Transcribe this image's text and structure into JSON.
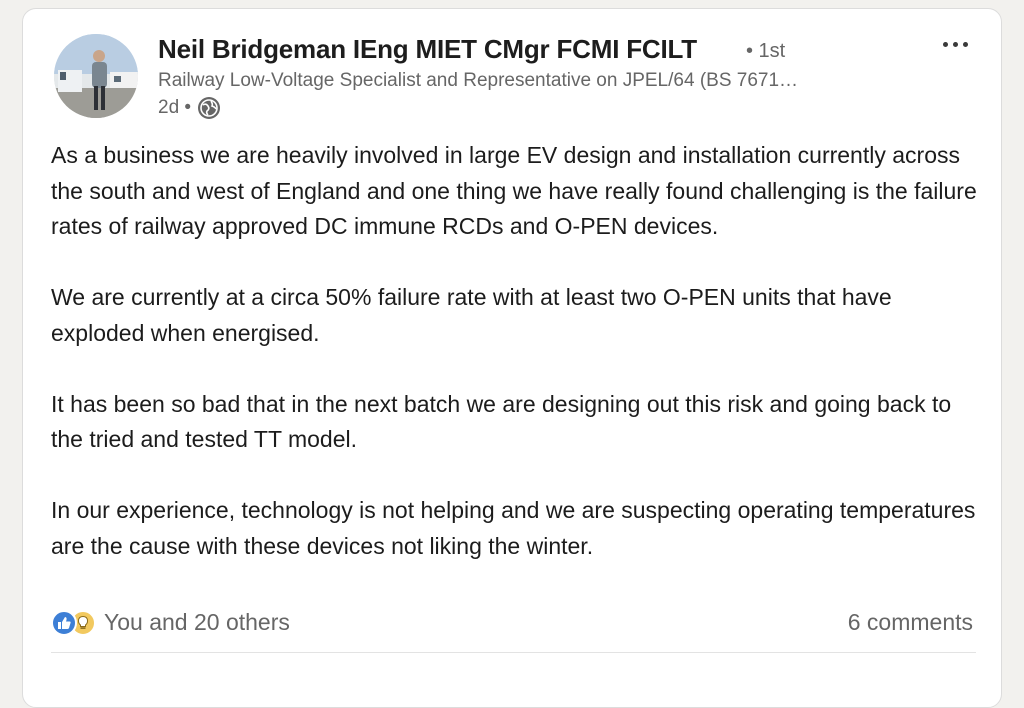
{
  "post": {
    "author": {
      "name": "Neil Bridgeman IEng MIET CMgr FCMI FCILT",
      "degree": "• 1st",
      "headline": "Railway Low-Voltage Specialist and Representative on JPEL/64 (BS 7671…",
      "time": "2d •"
    },
    "body": [
      "As a business we are heavily involved in large EV design and installation currently across the south and west of England and one thing we have really found challenging is the failure rates of railway approved DC immune RCDs and O-PEN devices.",
      "We are currently at a circa 50% failure rate with at least two O-PEN units that have exploded when energised.",
      "It has been so bad that in the next batch we are designing out this risk and going back to the tried and tested TT model.",
      "In our experience, technology is not helping and we are suspecting operating temperatures are the cause with these devices not liking the winter."
    ],
    "reactions_text": "You and 20 others",
    "reaction_icons": [
      "like-icon",
      "idea-icon"
    ],
    "comments_text": "6 comments",
    "visibility_icon": "globe-icon",
    "menu_icon": "more-options-icon"
  },
  "colors": {
    "background": "#f2f1ee",
    "card": "#ffffff",
    "text_primary": "#1c1c1c",
    "text_secondary": "#666666",
    "like_blue": "#3d7fd6",
    "idea_yellow": "#f2c95f"
  }
}
